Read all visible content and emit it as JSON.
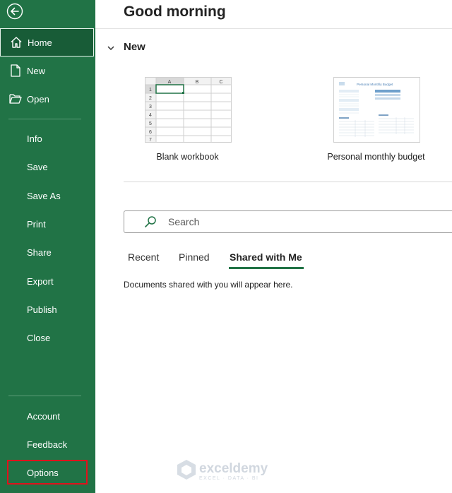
{
  "sidebar": {
    "back_icon": "back-arrow-icon",
    "home": "Home",
    "new": "New",
    "open": "Open",
    "info": "Info",
    "save": "Save",
    "save_as": "Save As",
    "print": "Print",
    "share": "Share",
    "export": "Export",
    "publish": "Publish",
    "close": "Close",
    "account": "Account",
    "feedback": "Feedback",
    "options": "Options"
  },
  "main": {
    "greeting": "Good morning",
    "new_section": "New",
    "templates": [
      {
        "label": "Blank workbook",
        "columns": [
          "A",
          "B",
          "C"
        ],
        "rows": [
          "1",
          "2",
          "3",
          "4",
          "5",
          "6",
          "7"
        ]
      },
      {
        "label": "Personal monthly budget",
        "thumb_title": "Personal Monthly Budget"
      }
    ],
    "search_placeholder": "Search",
    "tabs": [
      "Recent",
      "Pinned",
      "Shared with Me"
    ],
    "active_tab": "Shared with Me",
    "empty_message": "Documents shared with you will appear here."
  },
  "watermark": {
    "title": "exceldemy",
    "subtitle": "EXCEL · DATA · BI"
  },
  "colors": {
    "sidebar": "#217346",
    "active": "#185c37",
    "highlight_box": "#e0121c",
    "tab_underline": "#217346"
  }
}
